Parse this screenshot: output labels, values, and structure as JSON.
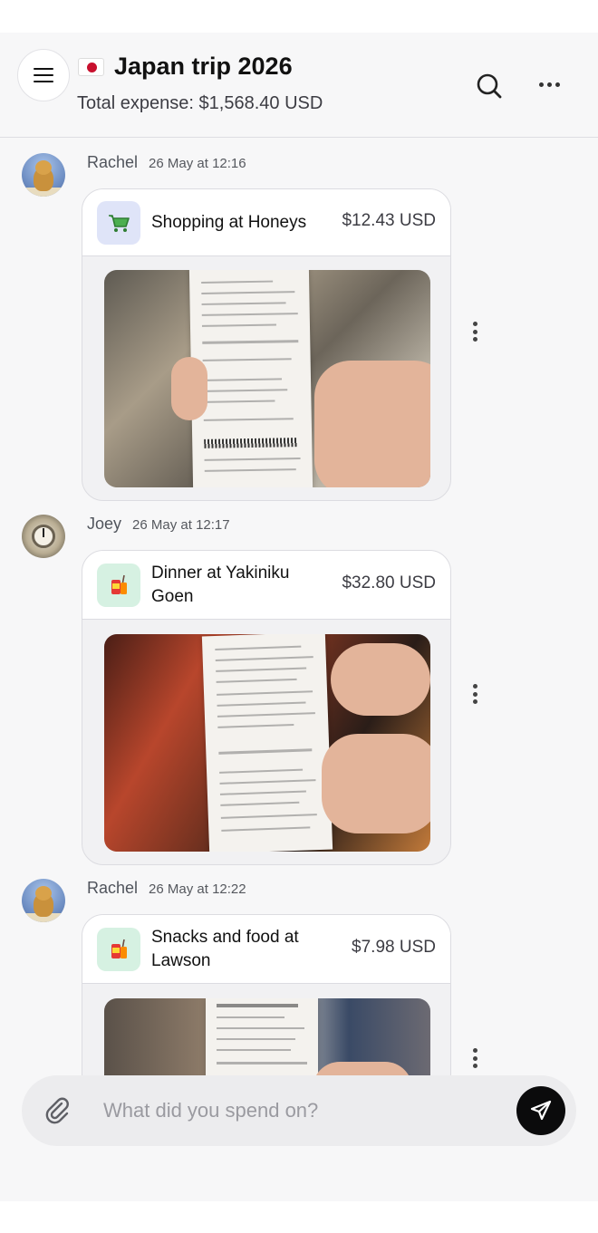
{
  "header": {
    "flag_icon": "japan-flag-icon",
    "title": "Japan trip 2026",
    "subtitle": "Total expense: $1,568.40 USD",
    "menu_icon": "hamburger-menu-icon",
    "search_icon": "search-icon",
    "more_icon": "more-horizontal-icon"
  },
  "messages": [
    {
      "author": "Rachel",
      "time": "26 May at 12:16",
      "category_icon": "shopping-cart-icon",
      "title": "Shopping at Honeys",
      "amount": "$12.43 USD",
      "photo": "receipt-photo"
    },
    {
      "author": "Joey",
      "time": "26 May at 12:17",
      "category_icon": "food-drink-icon",
      "title": "Dinner at Yakiniku Goen",
      "amount": "$32.80 USD",
      "photo": "receipt-photo"
    },
    {
      "author": "Rachel",
      "time": "26 May at 12:22",
      "category_icon": "food-drink-icon",
      "title": "Snacks and food at Lawson",
      "amount": "$7.98 USD",
      "photo": "receipt-photo"
    }
  ],
  "composer": {
    "placeholder": "What did you spend on?",
    "attach_icon": "paperclip-icon",
    "send_icon": "send-icon"
  },
  "colors": {
    "background": "#f7f7f8",
    "send_button": "#0b0b0c",
    "shop_tile": "#dfe4f8",
    "food_tile": "#d6f1e2"
  }
}
